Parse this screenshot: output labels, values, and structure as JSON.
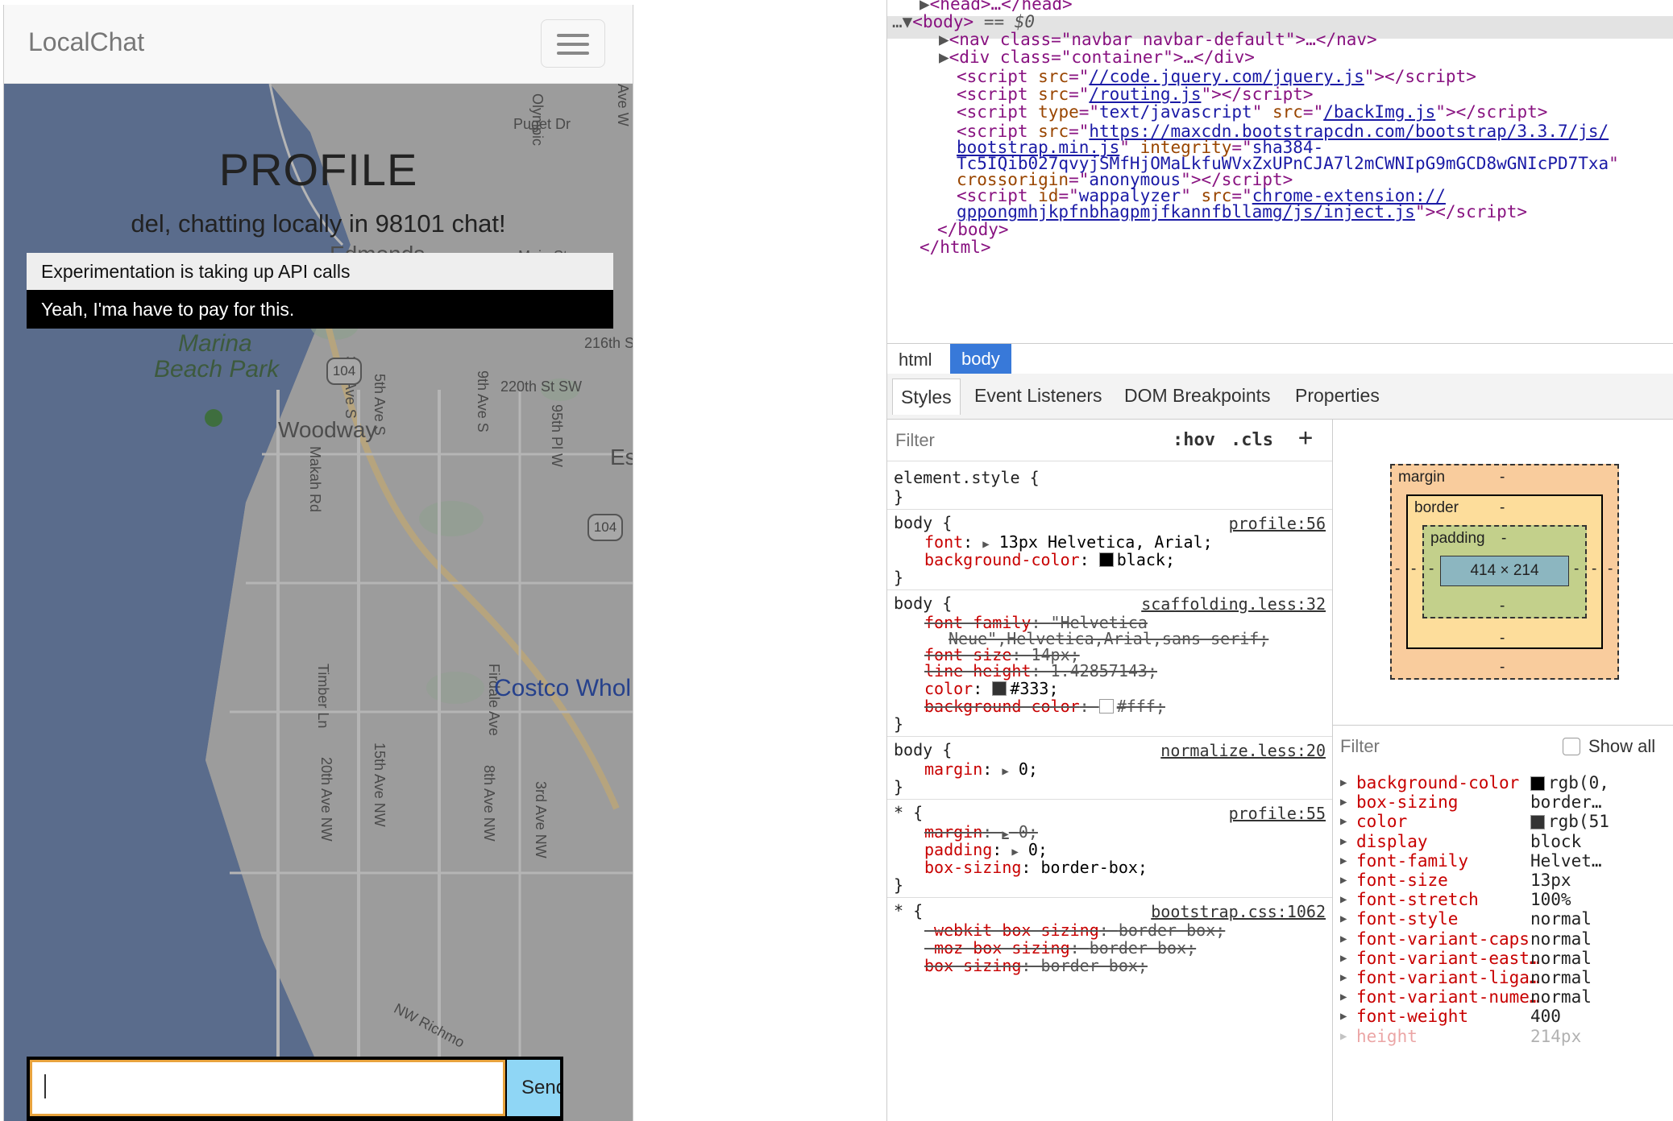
{
  "app": {
    "brand": "LocalChat",
    "profile_title": "PROFILE",
    "profile_subtitle": "del, chatting locally in 98101 chat!",
    "messages": [
      "Experimentation is taking up API calls",
      "Yeah, I'ma have to pay for this."
    ],
    "send_label": "Send",
    "input_value": ""
  },
  "map": {
    "labels": [
      "Puget Dr",
      "Olympic",
      "Ave W",
      "Edmonds",
      "Main St",
      "3rd Ave S",
      "5th Ave S",
      "9th Ave S",
      "216th S",
      "Marina",
      "Beach Park",
      "Makah Rd",
      "220th St SW",
      "95th Pl W",
      "Woodway",
      "Es",
      "Timber Ln",
      "20th Ave NW",
      "15th Ave NW",
      "8th Ave NW",
      "3rd Ave NW",
      "Firdale Ave",
      "Costco Whol",
      "NW Richmo"
    ],
    "shields": [
      "104",
      "104"
    ]
  },
  "devtools": {
    "dom": {
      "head_line": "<head>…</head>",
      "body_open": "<body>",
      "body_marker": "== $0",
      "nav_line": "<nav class=\"navbar navbar-default\">…</nav>",
      "div_line": "<div class=\"container\">…</div>",
      "script1": "//code.jquery.com/jquery.js",
      "script2": "/routing.js",
      "script3_type": "text/javascript",
      "script3": "/backImg.js",
      "script4a": "https://maxcdn.bootstrapcdn.com/bootstrap/3.3.7/js/",
      "script4b": "bootstrap.min.js",
      "integrity_a": "sha384-",
      "integrity_b": "Tc5IQib027qvyjSMfHjOMaLkfuWVxZxUPnCJA7l2mCWNIpG9mGCD8wGNIcPD7Txa",
      "crossorigin": "anonymous",
      "script5_id": "wappalyzer",
      "script5a": "chrome-extension://",
      "script5b": "gppongmhjkpfnbhagpmjfkannfbllamg/js/inject.js",
      "body_close": "</body>",
      "html_close": "</html>"
    },
    "breadcrumbs": [
      "html",
      "body"
    ],
    "tabs": [
      "Styles",
      "Event Listeners",
      "DOM Breakpoints",
      "Properties"
    ],
    "styles": {
      "filter_placeholder": "Filter",
      "hov": ":hov",
      "cls": ".cls",
      "plus": "+",
      "element_style": "element.style {",
      "close": "}",
      "rules": [
        {
          "selector": "body {",
          "source": "profile:56"
        },
        {
          "selector": "body {",
          "source": "scaffolding.less:32"
        },
        {
          "selector": "body {",
          "source": "normalize.less:20"
        },
        {
          "selector": "* {",
          "source": "profile:55"
        },
        {
          "selector": "* {",
          "source": "bootstrap.css:1062"
        }
      ],
      "r1_font": "13px Helvetica, Arial;",
      "r1_bg": "black;",
      "r2_ff1": "\"Helvetica",
      "r2_ff2": "Neue\",Helvetica,Arial,sans-serif;",
      "r2_fs": "14px;",
      "r2_lh": "1.42857143;",
      "r2_color": "#333;",
      "r2_bg": "#fff;",
      "r3_margin": "0;",
      "r4_margin": "0;",
      "r4_padding": "0;",
      "r4_bs": "border-box;",
      "r5_wk": "border-box;",
      "r5_moz": "border-box;",
      "r5_bs": "border-box;"
    },
    "boxmodel": {
      "margin": "margin",
      "border": "border",
      "padding": "padding",
      "dash": "-",
      "content": "414 × 214"
    },
    "computed": {
      "filter_placeholder": "Filter",
      "show_all": "Show all",
      "rows": [
        {
          "name": "background-color",
          "value": "rgb(0,",
          "swatch": "#000000"
        },
        {
          "name": "box-sizing",
          "value": "border…"
        },
        {
          "name": "color",
          "value": "rgb(51",
          "swatch": "#333333"
        },
        {
          "name": "display",
          "value": "block"
        },
        {
          "name": "font-family",
          "value": "Helvet…"
        },
        {
          "name": "font-size",
          "value": "13px"
        },
        {
          "name": "font-stretch",
          "value": "100%"
        },
        {
          "name": "font-style",
          "value": "normal"
        },
        {
          "name": "font-variant-caps",
          "value": "normal"
        },
        {
          "name": "font-variant-east…",
          "value": "normal"
        },
        {
          "name": "font-variant-liga…",
          "value": "normal"
        },
        {
          "name": "font-variant-nume…",
          "value": "normal"
        },
        {
          "name": "font-weight",
          "value": "400"
        },
        {
          "name": "height",
          "value": "214px"
        }
      ]
    }
  },
  "colors": {
    "accent_blue": "#3879d9",
    "input_border": "#e8a33d",
    "send_bg": "#8fd6f5",
    "prop_red": "#c80000"
  }
}
